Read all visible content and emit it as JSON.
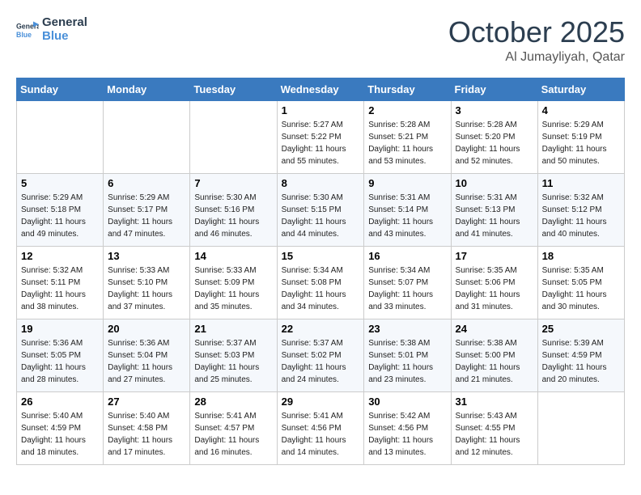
{
  "logo": {
    "line1": "General",
    "line2": "Blue"
  },
  "title": "October 2025",
  "location": "Al Jumayliyah, Qatar",
  "weekdays": [
    "Sunday",
    "Monday",
    "Tuesday",
    "Wednesday",
    "Thursday",
    "Friday",
    "Saturday"
  ],
  "weeks": [
    [
      {
        "day": "",
        "sunrise": "",
        "sunset": "",
        "daylight": ""
      },
      {
        "day": "",
        "sunrise": "",
        "sunset": "",
        "daylight": ""
      },
      {
        "day": "",
        "sunrise": "",
        "sunset": "",
        "daylight": ""
      },
      {
        "day": "1",
        "sunrise": "Sunrise: 5:27 AM",
        "sunset": "Sunset: 5:22 PM",
        "daylight": "Daylight: 11 hours and 55 minutes."
      },
      {
        "day": "2",
        "sunrise": "Sunrise: 5:28 AM",
        "sunset": "Sunset: 5:21 PM",
        "daylight": "Daylight: 11 hours and 53 minutes."
      },
      {
        "day": "3",
        "sunrise": "Sunrise: 5:28 AM",
        "sunset": "Sunset: 5:20 PM",
        "daylight": "Daylight: 11 hours and 52 minutes."
      },
      {
        "day": "4",
        "sunrise": "Sunrise: 5:29 AM",
        "sunset": "Sunset: 5:19 PM",
        "daylight": "Daylight: 11 hours and 50 minutes."
      }
    ],
    [
      {
        "day": "5",
        "sunrise": "Sunrise: 5:29 AM",
        "sunset": "Sunset: 5:18 PM",
        "daylight": "Daylight: 11 hours and 49 minutes."
      },
      {
        "day": "6",
        "sunrise": "Sunrise: 5:29 AM",
        "sunset": "Sunset: 5:17 PM",
        "daylight": "Daylight: 11 hours and 47 minutes."
      },
      {
        "day": "7",
        "sunrise": "Sunrise: 5:30 AM",
        "sunset": "Sunset: 5:16 PM",
        "daylight": "Daylight: 11 hours and 46 minutes."
      },
      {
        "day": "8",
        "sunrise": "Sunrise: 5:30 AM",
        "sunset": "Sunset: 5:15 PM",
        "daylight": "Daylight: 11 hours and 44 minutes."
      },
      {
        "day": "9",
        "sunrise": "Sunrise: 5:31 AM",
        "sunset": "Sunset: 5:14 PM",
        "daylight": "Daylight: 11 hours and 43 minutes."
      },
      {
        "day": "10",
        "sunrise": "Sunrise: 5:31 AM",
        "sunset": "Sunset: 5:13 PM",
        "daylight": "Daylight: 11 hours and 41 minutes."
      },
      {
        "day": "11",
        "sunrise": "Sunrise: 5:32 AM",
        "sunset": "Sunset: 5:12 PM",
        "daylight": "Daylight: 11 hours and 40 minutes."
      }
    ],
    [
      {
        "day": "12",
        "sunrise": "Sunrise: 5:32 AM",
        "sunset": "Sunset: 5:11 PM",
        "daylight": "Daylight: 11 hours and 38 minutes."
      },
      {
        "day": "13",
        "sunrise": "Sunrise: 5:33 AM",
        "sunset": "Sunset: 5:10 PM",
        "daylight": "Daylight: 11 hours and 37 minutes."
      },
      {
        "day": "14",
        "sunrise": "Sunrise: 5:33 AM",
        "sunset": "Sunset: 5:09 PM",
        "daylight": "Daylight: 11 hours and 35 minutes."
      },
      {
        "day": "15",
        "sunrise": "Sunrise: 5:34 AM",
        "sunset": "Sunset: 5:08 PM",
        "daylight": "Daylight: 11 hours and 34 minutes."
      },
      {
        "day": "16",
        "sunrise": "Sunrise: 5:34 AM",
        "sunset": "Sunset: 5:07 PM",
        "daylight": "Daylight: 11 hours and 33 minutes."
      },
      {
        "day": "17",
        "sunrise": "Sunrise: 5:35 AM",
        "sunset": "Sunset: 5:06 PM",
        "daylight": "Daylight: 11 hours and 31 minutes."
      },
      {
        "day": "18",
        "sunrise": "Sunrise: 5:35 AM",
        "sunset": "Sunset: 5:05 PM",
        "daylight": "Daylight: 11 hours and 30 minutes."
      }
    ],
    [
      {
        "day": "19",
        "sunrise": "Sunrise: 5:36 AM",
        "sunset": "Sunset: 5:05 PM",
        "daylight": "Daylight: 11 hours and 28 minutes."
      },
      {
        "day": "20",
        "sunrise": "Sunrise: 5:36 AM",
        "sunset": "Sunset: 5:04 PM",
        "daylight": "Daylight: 11 hours and 27 minutes."
      },
      {
        "day": "21",
        "sunrise": "Sunrise: 5:37 AM",
        "sunset": "Sunset: 5:03 PM",
        "daylight": "Daylight: 11 hours and 25 minutes."
      },
      {
        "day": "22",
        "sunrise": "Sunrise: 5:37 AM",
        "sunset": "Sunset: 5:02 PM",
        "daylight": "Daylight: 11 hours and 24 minutes."
      },
      {
        "day": "23",
        "sunrise": "Sunrise: 5:38 AM",
        "sunset": "Sunset: 5:01 PM",
        "daylight": "Daylight: 11 hours and 23 minutes."
      },
      {
        "day": "24",
        "sunrise": "Sunrise: 5:38 AM",
        "sunset": "Sunset: 5:00 PM",
        "daylight": "Daylight: 11 hours and 21 minutes."
      },
      {
        "day": "25",
        "sunrise": "Sunrise: 5:39 AM",
        "sunset": "Sunset: 4:59 PM",
        "daylight": "Daylight: 11 hours and 20 minutes."
      }
    ],
    [
      {
        "day": "26",
        "sunrise": "Sunrise: 5:40 AM",
        "sunset": "Sunset: 4:59 PM",
        "daylight": "Daylight: 11 hours and 18 minutes."
      },
      {
        "day": "27",
        "sunrise": "Sunrise: 5:40 AM",
        "sunset": "Sunset: 4:58 PM",
        "daylight": "Daylight: 11 hours and 17 minutes."
      },
      {
        "day": "28",
        "sunrise": "Sunrise: 5:41 AM",
        "sunset": "Sunset: 4:57 PM",
        "daylight": "Daylight: 11 hours and 16 minutes."
      },
      {
        "day": "29",
        "sunrise": "Sunrise: 5:41 AM",
        "sunset": "Sunset: 4:56 PM",
        "daylight": "Daylight: 11 hours and 14 minutes."
      },
      {
        "day": "30",
        "sunrise": "Sunrise: 5:42 AM",
        "sunset": "Sunset: 4:56 PM",
        "daylight": "Daylight: 11 hours and 13 minutes."
      },
      {
        "day": "31",
        "sunrise": "Sunrise: 5:43 AM",
        "sunset": "Sunset: 4:55 PM",
        "daylight": "Daylight: 11 hours and 12 minutes."
      },
      {
        "day": "",
        "sunrise": "",
        "sunset": "",
        "daylight": ""
      }
    ]
  ]
}
